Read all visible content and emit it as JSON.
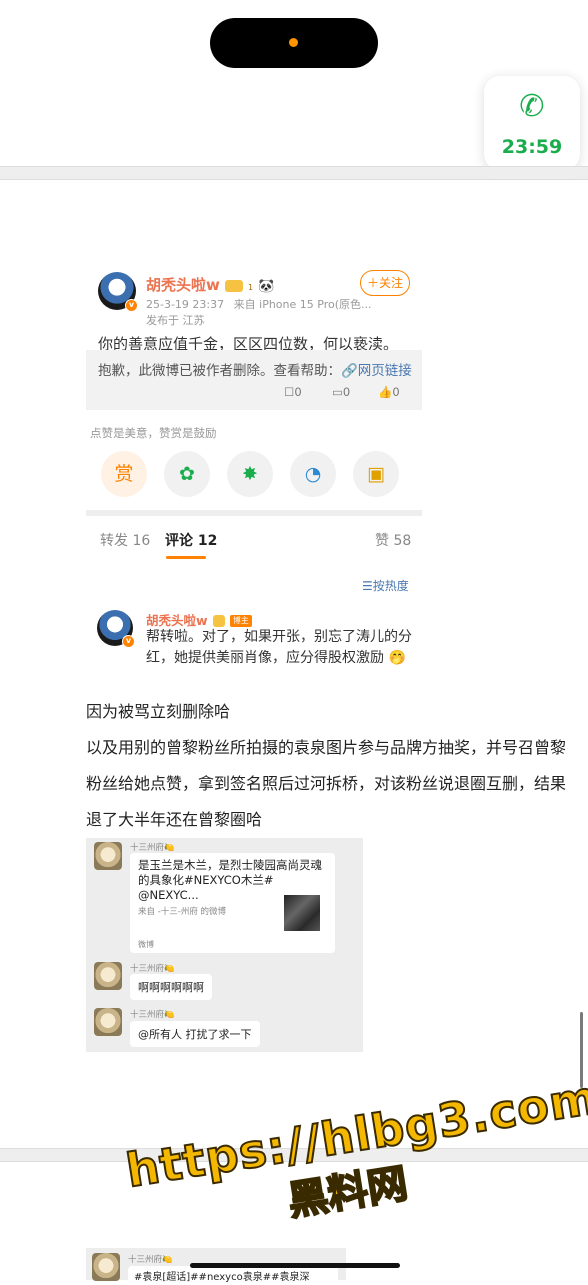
{
  "status": {
    "call_time": "23:59"
  },
  "post": {
    "author": "胡秃头啦w",
    "vip_level": "1",
    "timestamp": "25-3-19 23:37",
    "source": "来自 iPhone 15 Pro(原色...",
    "location": "发布于 江苏",
    "follow_label": "＋关注",
    "text": "你的善意应值千金，区区四位数，何以亵渎。",
    "deleted_notice": "抱歉，此微博已被作者删除。查看帮助：",
    "help_link": "🔗网页链接",
    "repost_count": "0",
    "comment_count": "0",
    "like_count": "0"
  },
  "reward": {
    "tip": "点赞是美意，赞赏是鼓励",
    "reward_label": "赏"
  },
  "tabs": {
    "repost": "转发 16",
    "comments": "评论 12",
    "likes": "赞 58"
  },
  "sort": {
    "label": "☰按热度"
  },
  "comment": {
    "author": "胡秃头啦w",
    "badge": "博主",
    "text": "帮转啦。对了，如果开张，别忘了涛儿的分红，她提供美丽肖像，应分得股权激励 🤭"
  },
  "article": {
    "lines": [
      "因为被骂立刻删除哈",
      "以及用别的曾黎粉丝所拍摄的袁泉图片参与品牌方抽奖，并号召曾黎",
      "粉丝给她点赞，拿到签名照后过河拆桥，对该粉丝说退圈互删，结果",
      "退了大半年还在曾黎圈哈"
    ]
  },
  "chat": {
    "name": "十三州府🍋",
    "card_text": "是玉兰是木兰，是烈士陵园高尚灵魂的具象化#NEXYCO木兰# @NEXYC...",
    "card_source": "来自 -十三-州府 的微博",
    "card_app": "微博",
    "msg2": "啊啊啊啊啊啊",
    "msg3": "@所有人  打扰了求一下",
    "bottom_text": "#袁泉[超话]##nexyco袁泉##袁泉深"
  },
  "watermark": {
    "url": "https://hlbg3.com",
    "site": "黑料网"
  }
}
